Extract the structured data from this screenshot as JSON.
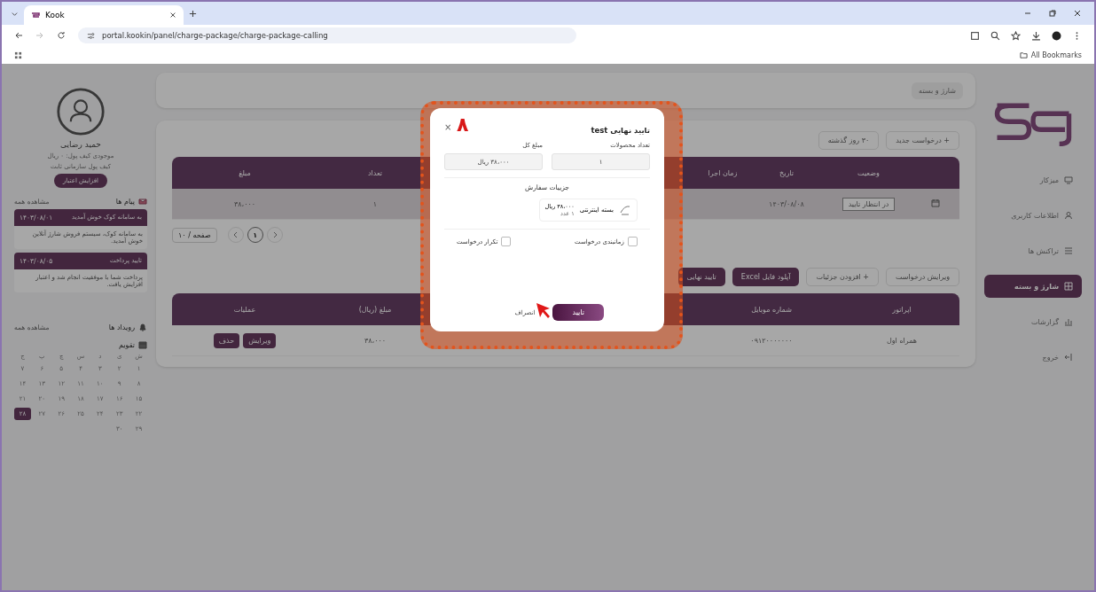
{
  "browser": {
    "tab_title": "Kook",
    "url": "portal.kookin/panel/charge-package/charge-package-calling",
    "bookmarks": "All Bookmarks"
  },
  "sidebar": {
    "items": [
      {
        "label": "میزکار",
        "selected": false
      },
      {
        "label": "اطلاعات کاربری",
        "selected": false
      },
      {
        "label": "تراکنش ها",
        "selected": false
      },
      {
        "label": "شارژ و بسته",
        "selected": true
      },
      {
        "label": "گزارشات",
        "selected": false
      },
      {
        "label": "خروج",
        "selected": false
      }
    ]
  },
  "breadcrumb": "شارژ و بسته",
  "toolbar": {
    "new_request": "+ درخواست جدید",
    "period": "۳۰ روز گذشته"
  },
  "requests_table": {
    "columns": [
      "وضعیت",
      "تاریخ",
      "زمان اجرا",
      "تعداد",
      "مبلغ"
    ],
    "rows": [
      {
        "status": "در انتظار تایید",
        "date": "۱۴۰۳/۰۸/۰۸",
        "time": "",
        "count": "۱",
        "amount": "۳۸،۰۰۰"
      }
    ]
  },
  "pagination": {
    "pages": [
      {
        "label": "۱",
        "selected": true
      }
    ],
    "page_size": "۱۰ / صفحه"
  },
  "detail_toolbar": [
    {
      "label": "ویرایش درخواست",
      "kind": "plain"
    },
    {
      "label": "+ افزودن جزئیات",
      "kind": "plain"
    },
    {
      "label": "آپلود فایل Excel",
      "kind": "dark"
    },
    {
      "label": "تایید نهایی",
      "kind": "dark"
    }
  ],
  "details_table": {
    "columns": [
      "اپراتور",
      "شماره موبایل",
      "مبلغ (ریال)",
      "عملیات"
    ],
    "rows": [
      {
        "operator": "همراه اول",
        "mobile": "۰۹۱۲۰۰۰۰۰۰۰",
        "amount": "۳۸،۰۰۰",
        "actions": [
          "ویرایش",
          "حذف"
        ]
      }
    ]
  },
  "profile": {
    "name": "حمید رضایی",
    "subtitle": "موجودی کیف پول: ۰ ریال",
    "wallet": "کیف پول سازمانی ثابت",
    "charge_button": "افزایش اعتبار"
  },
  "messages": {
    "title": "پیام ها",
    "more": "مشاهده همه",
    "items": [
      {
        "title": "به سامانه کوک خوش آمدید",
        "date": "۱۴۰۳/۰۸/۰۱",
        "body": "به سامانه کوک، سیستم فروش شارژ آنلاین خوش آمدید."
      },
      {
        "title": "تایید پرداخت",
        "date": "۱۴۰۳/۰۸/۰۵",
        "body": "پرداخت شما با موفقیت انجام شد و اعتبار افزایش یافت."
      }
    ]
  },
  "events": {
    "title": "رویداد ها",
    "more": "مشاهده همه"
  },
  "calendar": {
    "title": "تقویم",
    "weekdays": [
      "ش",
      "ی",
      "د",
      "س",
      "چ",
      "پ",
      "ج"
    ],
    "days": [
      {
        "label": "۱",
        "selected": false
      },
      {
        "label": "۲",
        "selected": false
      },
      {
        "label": "۳",
        "selected": false
      },
      {
        "label": "۴",
        "selected": false
      },
      {
        "label": "۵",
        "selected": false
      },
      {
        "label": "۶",
        "selected": false
      },
      {
        "label": "۷",
        "selected": false
      },
      {
        "label": "۸",
        "selected": false
      },
      {
        "label": "۹",
        "selected": false
      },
      {
        "label": "۱۰",
        "selected": false
      },
      {
        "label": "۱۱",
        "selected": false
      },
      {
        "label": "۱۲",
        "selected": false
      },
      {
        "label": "۱۳",
        "selected": false
      },
      {
        "label": "۱۴",
        "selected": false
      },
      {
        "label": "۱۵",
        "selected": false
      },
      {
        "label": "۱۶",
        "selected": false
      },
      {
        "label": "۱۷",
        "selected": false
      },
      {
        "label": "۱۸",
        "selected": false
      },
      {
        "label": "۱۹",
        "selected": false
      },
      {
        "label": "۲۰",
        "selected": false
      },
      {
        "label": "۲۱",
        "selected": false
      },
      {
        "label": "۲۲",
        "selected": false
      },
      {
        "label": "۲۳",
        "selected": false
      },
      {
        "label": "۲۴",
        "selected": false
      },
      {
        "label": "۲۵",
        "selected": false
      },
      {
        "label": "۲۶",
        "selected": false
      },
      {
        "label": "۲۷",
        "selected": false
      },
      {
        "label": "۲۸",
        "selected": true
      },
      {
        "label": "۲۹",
        "selected": false
      },
      {
        "label": "۳۰",
        "selected": false
      }
    ]
  },
  "modal": {
    "title": "تایید نهایی test",
    "close": "×",
    "annotation": "۸",
    "count_label": "تعداد محصولات",
    "count_value": "۱",
    "total_label": "مبلغ کل",
    "total_value": "۳۸،۰۰۰ ریال",
    "details_title": "جزییات سفارش",
    "item": {
      "name": "بسته اینترنتی",
      "price": "۳۸،۰۰۰ ریال",
      "qty": "۱ عدد"
    },
    "options": [
      {
        "label": "زمانبندی درخواست",
        "checked": false
      },
      {
        "label": "تکرار درخواست",
        "checked": false
      }
    ],
    "confirm": "تایید",
    "cancel": "انصراف"
  }
}
